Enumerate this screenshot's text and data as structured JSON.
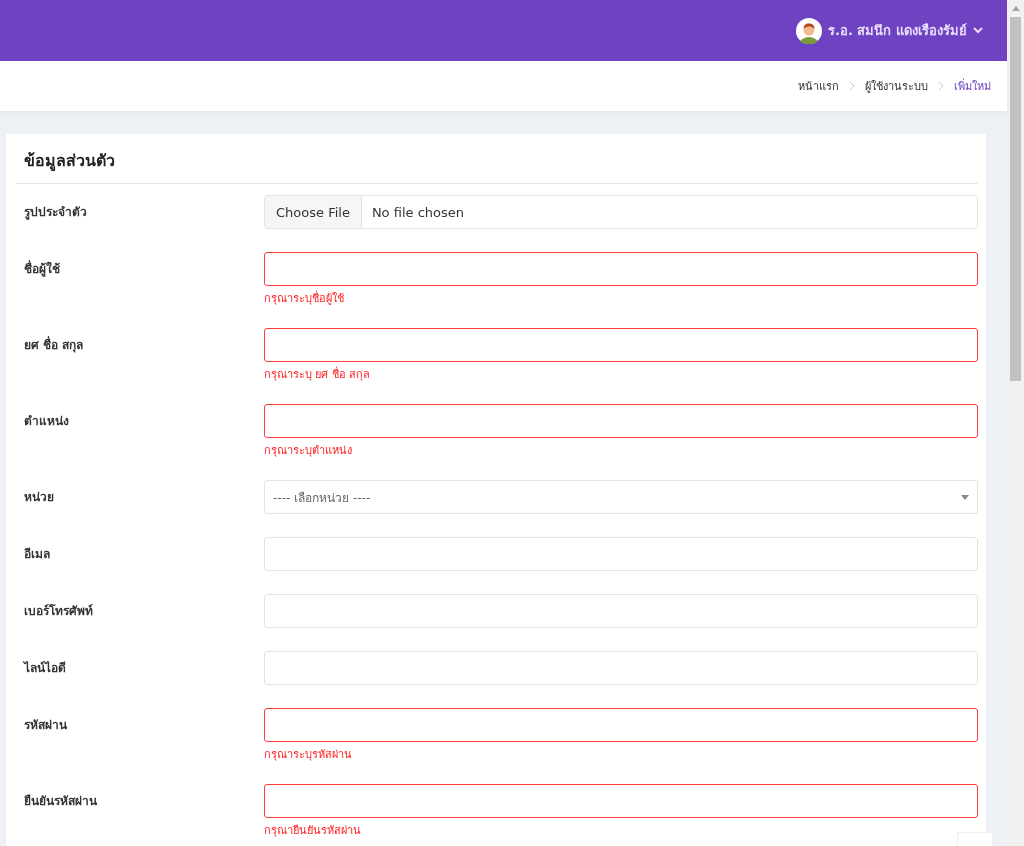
{
  "user_menu": {
    "name": "ร.อ. สมนึก แดงเรืองรัมย์"
  },
  "breadcrumb": [
    {
      "label": "หน้าแรก",
      "selected": false
    },
    {
      "label": "ผู้ใช้งานระบบ",
      "selected": false
    },
    {
      "label": "เพิ่มใหม่",
      "selected": true
    }
  ],
  "card": {
    "title": "ข้อมูลส่วนตัว",
    "fields": [
      {
        "kind": "file",
        "label": "รูปประจำตัว",
        "button": "Choose File",
        "value": "No file chosen",
        "invalid": false
      },
      {
        "kind": "text",
        "label": "ชื่อผู้ใช้",
        "invalid": true,
        "error": "กรุณาระบุชื่อผู้ใช้"
      },
      {
        "kind": "text",
        "label": "ยศ ชื่อ สกุล",
        "invalid": true,
        "error": "กรุณาระบุ ยศ ชื่อ สกุล"
      },
      {
        "kind": "text",
        "label": "ตำแหน่ง",
        "invalid": true,
        "error": "กรุณาระบุตำแหน่ง"
      },
      {
        "kind": "select",
        "label": "หน่วย",
        "value": "---- เลือกหน่วย ----",
        "invalid": false
      },
      {
        "kind": "text",
        "label": "อีเมล",
        "invalid": false
      },
      {
        "kind": "text",
        "label": "เบอร์โทรศัพท์",
        "invalid": false
      },
      {
        "kind": "text",
        "label": "ไลน์ไอดี",
        "invalid": false
      },
      {
        "kind": "text",
        "label": "รหัสผ่าน",
        "invalid": true,
        "error": "กรุณาระบุรหัสผ่าน"
      },
      {
        "kind": "text",
        "label": "ยืนยันรหัสผ่าน",
        "invalid": true,
        "error": "กรุณายืนยันรหัสผ่าน"
      }
    ]
  }
}
